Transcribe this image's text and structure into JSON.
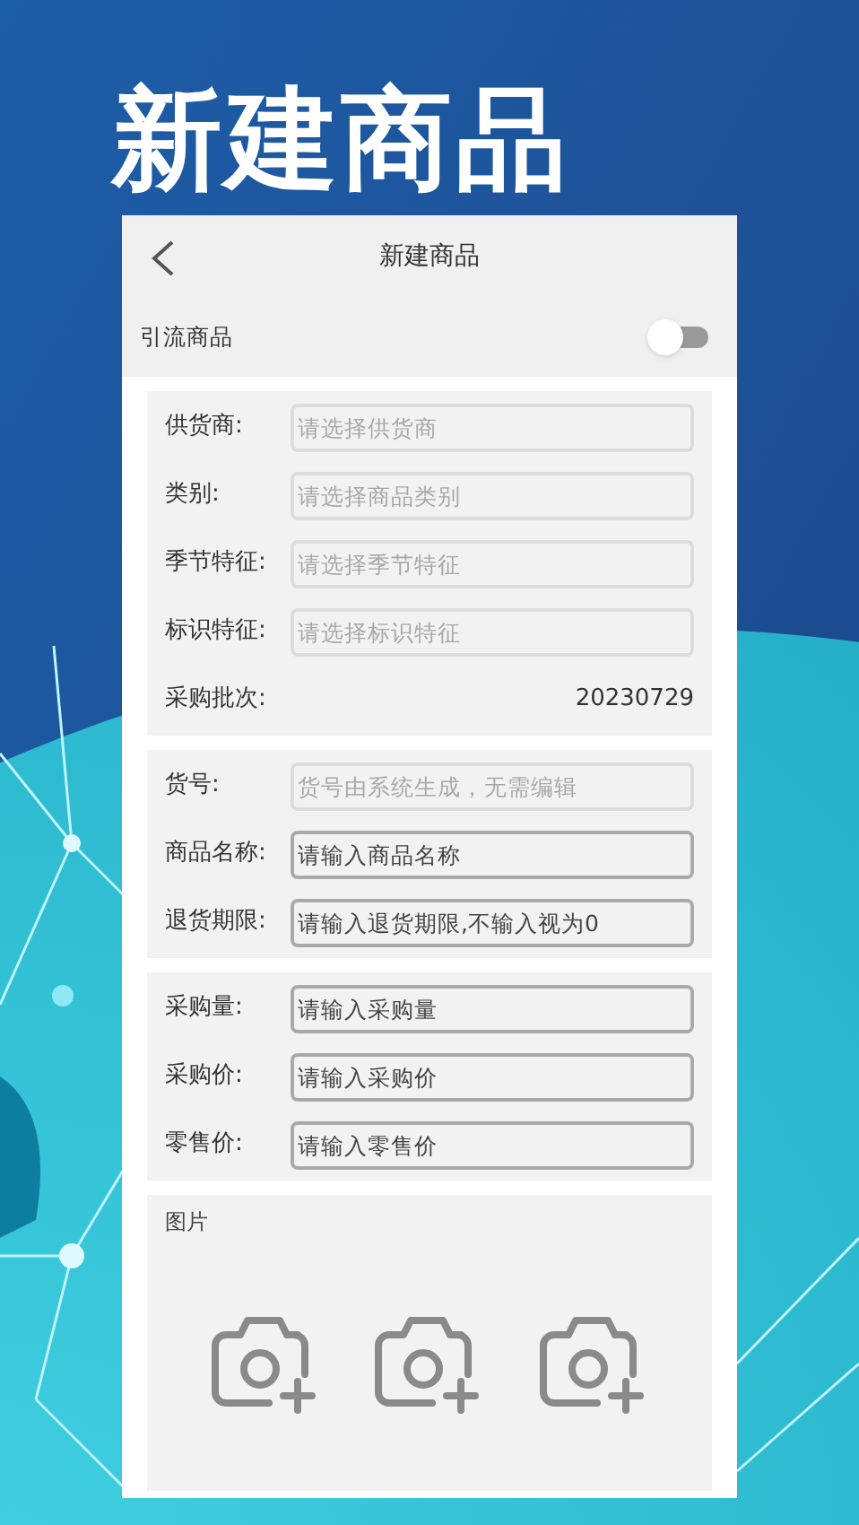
{
  "headline": "新建商品",
  "screen": {
    "title": "新建商品",
    "toggle": {
      "label": "引流商品",
      "on": false
    },
    "sections": [
      {
        "fields": [
          {
            "label": "供货商:",
            "kind": "picker",
            "placeholder": "请选择供货商"
          },
          {
            "label": "类别:",
            "kind": "picker",
            "placeholder": "请选择商品类别"
          },
          {
            "label": "季节特征:",
            "kind": "picker",
            "placeholder": "请选择季节特征"
          },
          {
            "label": "标识特征:",
            "kind": "picker",
            "placeholder": "请选择标识特征"
          },
          {
            "label": "采购批次:",
            "kind": "value",
            "value": "20230729"
          }
        ]
      },
      {
        "fields": [
          {
            "label": "货号:",
            "kind": "input",
            "disabled": true,
            "placeholder": "货号由系统生成，无需编辑"
          },
          {
            "label": "商品名称:",
            "kind": "input",
            "disabled": false,
            "placeholder": "请输入商品名称"
          },
          {
            "label": "退货期限:",
            "kind": "input",
            "disabled": false,
            "placeholder": "请输入退货期限,不输入视为0"
          }
        ]
      },
      {
        "fields": [
          {
            "label": "采购量:",
            "kind": "input",
            "disabled": false,
            "placeholder": "请输入采购量"
          },
          {
            "label": "采购价:",
            "kind": "input",
            "disabled": false,
            "placeholder": "请输入采购价"
          },
          {
            "label": "零售价:",
            "kind": "input",
            "disabled": false,
            "placeholder": "请输入零售价"
          }
        ]
      }
    ],
    "photos": {
      "label": "图片",
      "slots": [
        {
          "kind": "add"
        },
        {
          "kind": "add"
        },
        {
          "kind": "add"
        }
      ]
    }
  }
}
